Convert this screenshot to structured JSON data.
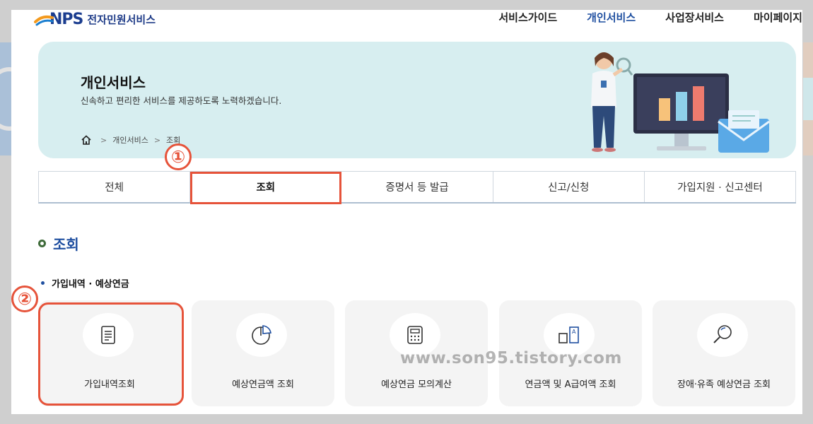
{
  "header": {
    "logo_text": "NPS",
    "service_title": "전자민원서비스",
    "nav": [
      {
        "label": "서비스가이드",
        "active": false
      },
      {
        "label": "개인서비스",
        "active": true
      },
      {
        "label": "사업장서비스",
        "active": false
      },
      {
        "label": "마이페이지",
        "active": false
      }
    ]
  },
  "banner": {
    "title": "개인서비스",
    "subtitle": "신속하고 편리한 서비스를 제공하도록 노력하겠습니다.",
    "breadcrumb": [
      "개인서비스",
      "조회"
    ],
    "breadcrumb_sep": ">"
  },
  "tabs": [
    {
      "label": "전체",
      "active": false
    },
    {
      "label": "조회",
      "active": true
    },
    {
      "label": "증명서 등 발급",
      "active": false
    },
    {
      "label": "신고/신청",
      "active": false
    },
    {
      "label": "가입지원 · 신고센터",
      "active": false
    }
  ],
  "section": {
    "title": "조회",
    "subtitle": "가입내역 · 예상연금"
  },
  "cards": [
    {
      "label": "가입내역조회",
      "icon": "document-list-icon"
    },
    {
      "label": "예상연금액 조회",
      "icon": "pie-chart-icon"
    },
    {
      "label": "예상연금 모의계산",
      "icon": "calculator-icon"
    },
    {
      "label": "연금액 및 A급여액 조회",
      "icon": "compare-icon"
    },
    {
      "label": "장애·유족 예상연금 조회",
      "icon": "magnifier-icon"
    }
  ],
  "annotations": {
    "step1": "①",
    "step2": "②",
    "highlight_color": "#e6533a"
  },
  "watermark": "www.son95.tistory.com",
  "colors": {
    "banner_bg": "#d7eef0",
    "brand_blue": "#1f4fa0",
    "card_bg": "#f4f4f4"
  }
}
